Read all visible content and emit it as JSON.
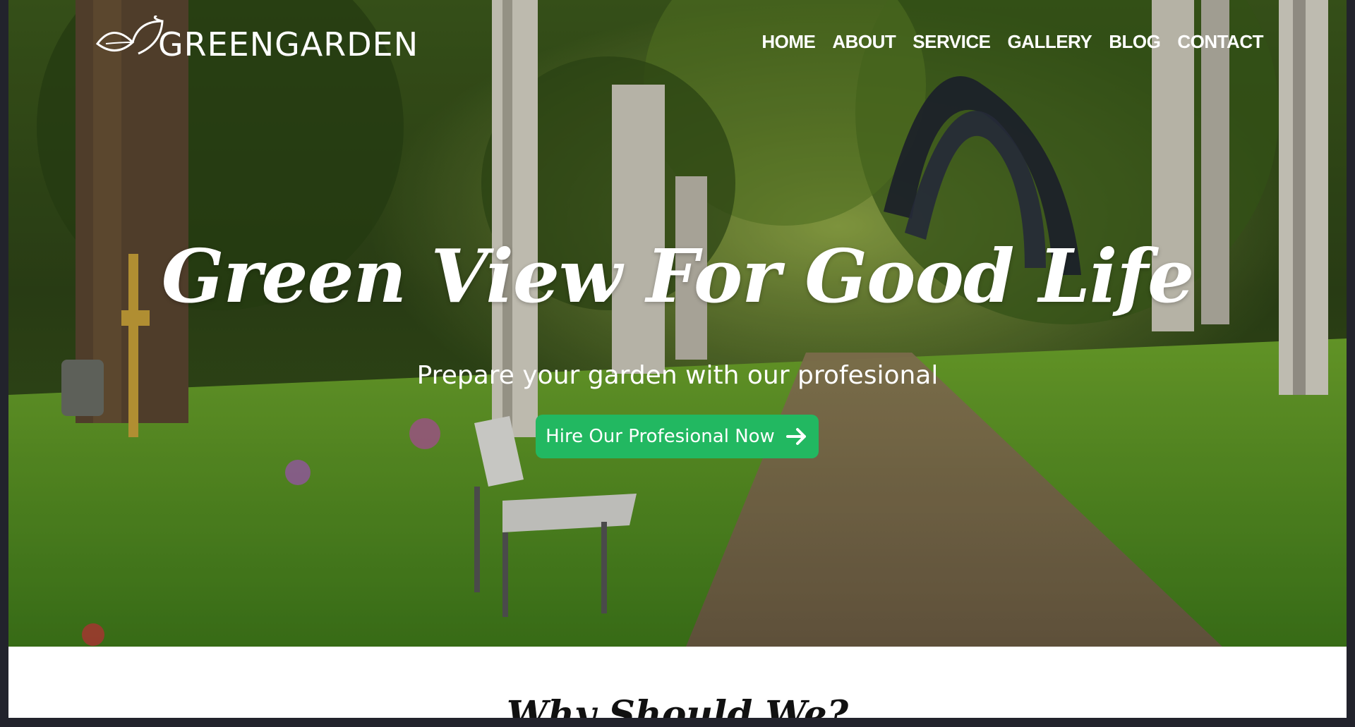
{
  "brand": {
    "name": "GREENGARDEN",
    "logo_icon": "leaf-icon"
  },
  "nav": {
    "items": [
      {
        "label": "HOME"
      },
      {
        "label": "ABOUT"
      },
      {
        "label": "SERVICE"
      },
      {
        "label": "GALLERY"
      },
      {
        "label": "BLOG"
      },
      {
        "label": "CONTACT"
      }
    ]
  },
  "hero": {
    "title": "Green View For Good Life",
    "subtitle": "Prepare your garden with our profesional",
    "cta_label": "Hire Our Profesional Now",
    "cta_icon": "arrow-right-icon",
    "cta_color": "#22b861"
  },
  "next_section": {
    "title": "Why Should We?"
  }
}
